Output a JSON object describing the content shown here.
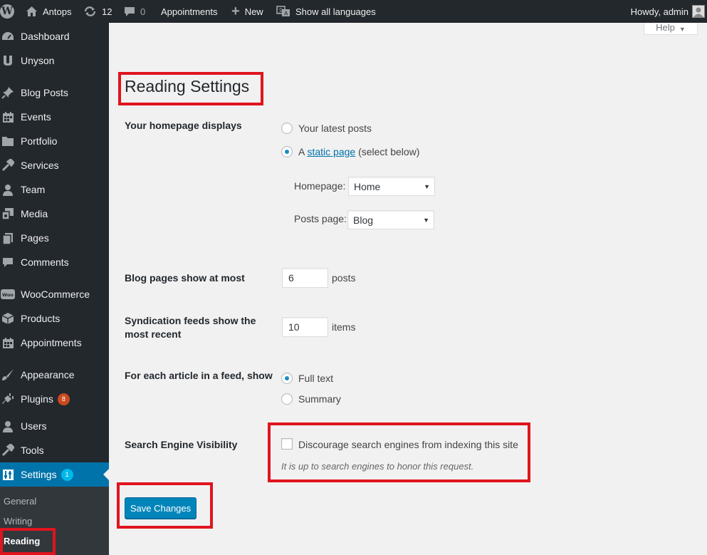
{
  "adminbar": {
    "site_name": "Antops",
    "updates_count": "12",
    "comments_count": "0",
    "appointments": "Appointments",
    "new": "New",
    "languages": "Show all languages",
    "howdy": "Howdy, admin"
  },
  "sidebar": {
    "items": [
      {
        "label": "Dashboard",
        "icon": "dashboard-icon"
      },
      {
        "label": "Unyson",
        "icon": "unyson-icon"
      },
      {
        "label": "Blog Posts",
        "icon": "pin-icon"
      },
      {
        "label": "Events",
        "icon": "calendar-icon"
      },
      {
        "label": "Portfolio",
        "icon": "folder-icon"
      },
      {
        "label": "Services",
        "icon": "wrench-icon"
      },
      {
        "label": "Team",
        "icon": "person-icon"
      },
      {
        "label": "Media",
        "icon": "media-icon"
      },
      {
        "label": "Pages",
        "icon": "pages-icon"
      },
      {
        "label": "Comments",
        "icon": "comment-icon"
      },
      {
        "label": "WooCommerce",
        "icon": "woo-icon"
      },
      {
        "label": "Products",
        "icon": "cube-icon"
      },
      {
        "label": "Appointments",
        "icon": "calendar-icon"
      },
      {
        "label": "Appearance",
        "icon": "brush-icon"
      },
      {
        "label": "Plugins",
        "icon": "plug-icon",
        "badge": "8"
      },
      {
        "label": "Users",
        "icon": "person-icon"
      },
      {
        "label": "Tools",
        "icon": "wrench-icon"
      },
      {
        "label": "Settings",
        "icon": "settings-icon",
        "badge": "1"
      }
    ],
    "submenu": [
      "General",
      "Writing",
      "Reading"
    ]
  },
  "help_tab": "Help",
  "page": {
    "title": "Reading Settings",
    "homepage_displays": {
      "label": "Your homepage displays",
      "option_latest": "Your latest posts",
      "option_static_prefix": "A",
      "option_static_link": "static page",
      "option_static_suffix": "(select below)",
      "selected": "static page",
      "homepage_label": "Homepage:",
      "homepage_value": "Home",
      "posts_page_label": "Posts page:",
      "posts_page_value": "Blog"
    },
    "blog_pages": {
      "label": "Blog pages show at most",
      "value": "6",
      "unit": "posts"
    },
    "syndication": {
      "label": "Syndication feeds show the most recent",
      "value": "10",
      "unit": "items"
    },
    "feed_article": {
      "label": "For each article in a feed, show",
      "option_full": "Full text",
      "option_summary": "Summary",
      "selected": "Full text"
    },
    "search_visibility": {
      "label": "Search Engine Visibility",
      "checkbox_label": "Discourage search engines from indexing this site",
      "checked": false,
      "description": "It is up to search engines to honor this request."
    },
    "save_button": "Save Changes"
  },
  "colors": {
    "highlight": "#e0141e",
    "accent": "#0073aa",
    "button": "#0085ba"
  }
}
